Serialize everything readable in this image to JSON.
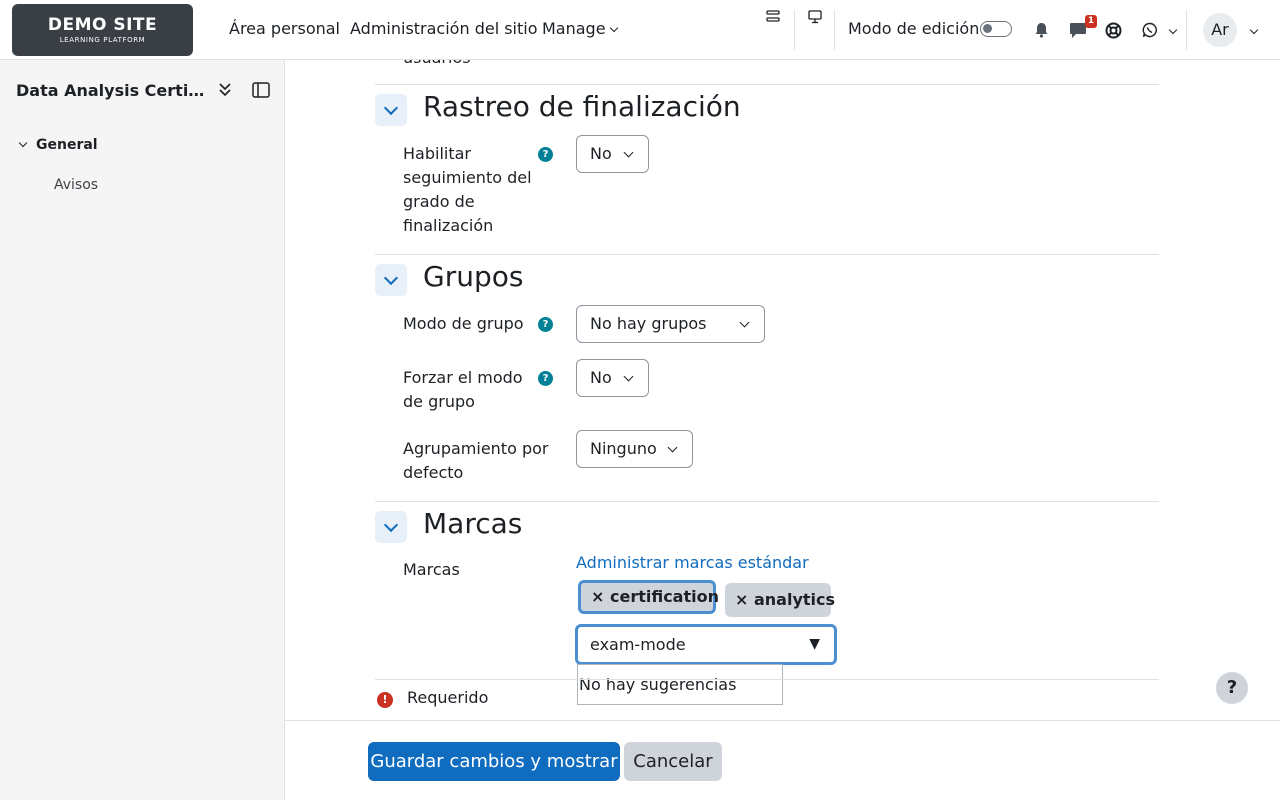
{
  "navbar": {
    "logo_title": "DEMO SITE",
    "logo_subtitle": "LEARNING PLATFORM",
    "links": [
      "Área personal",
      "Administración del sitio",
      "Manage"
    ],
    "edit_mode_label": "Modo de edición",
    "messages_badge": "1",
    "avatar_initials": "Ar"
  },
  "sidebar": {
    "course_title": "Data Analysis Certification",
    "section_label": "General",
    "items": [
      "Avisos"
    ]
  },
  "form": {
    "cut_text": "usuarios",
    "sections": {
      "completion": {
        "title": "Rastreo de finalización",
        "field_label": "Habilitar seguimiento del grado de finalización",
        "value": "No"
      },
      "groups": {
        "title": "Grupos",
        "group_mode_label": "Modo de grupo",
        "group_mode_value": "No hay grupos",
        "force_label": "Forzar el modo de grupo",
        "force_value": "No",
        "grouping_label": "Agrupamiento por defecto",
        "grouping_value": "Ninguno"
      },
      "tags": {
        "title": "Marcas",
        "field_label": "Marcas",
        "manage_link": "Administrar marcas estándar",
        "tags": [
          "× certification",
          "× analytics"
        ],
        "input_value": "exam-mode",
        "input_arrow": "▼",
        "suggestion": "No hay sugerencias"
      }
    },
    "required_icon": "!",
    "required_label": "Requerido"
  },
  "footer": {
    "save_label": "Guardar cambios y mostrar",
    "cancel_label": "Cancelar"
  },
  "help_float": "?",
  "help_icon": "?",
  "colors": {
    "primary": "#0f6cbf",
    "help": "#008196",
    "danger": "#ca3120",
    "focus": "#4b8ed1"
  }
}
